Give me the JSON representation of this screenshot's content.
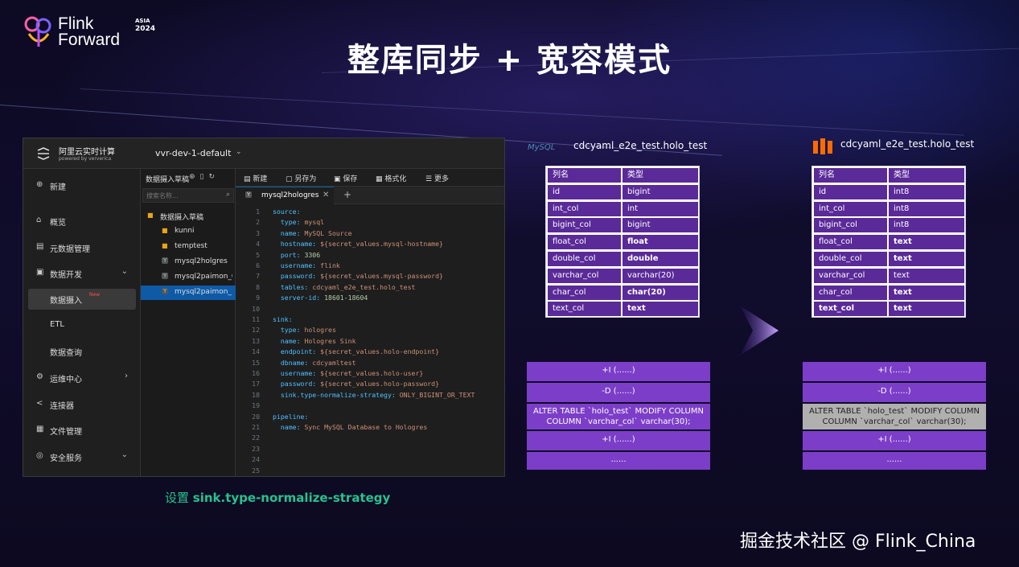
{
  "logo": {
    "line1": "Flink",
    "line2": "Forward",
    "event": "ASIA",
    "year": "2024"
  },
  "title": "整库同步 + 宽容模式",
  "app": {
    "brand": "阿里云实时计算",
    "brand_sub": "powered by ververica",
    "workspace": "vvr-dev-1-default",
    "sidebar": [
      {
        "label": "新建",
        "icon": "⊕"
      },
      {
        "label": "概览",
        "icon": "⌂"
      },
      {
        "label": "元数据管理",
        "icon": "▤"
      },
      {
        "label": "数据开发",
        "icon": "▣"
      },
      {
        "label": "数据摄入",
        "badge": "New"
      },
      {
        "label": "ETL"
      },
      {
        "label": "数据查询"
      },
      {
        "label": "运维中心",
        "icon": "⚙"
      },
      {
        "label": "连接器",
        "icon": "<"
      },
      {
        "label": "文件管理",
        "icon": "▦"
      },
      {
        "label": "安全服务",
        "icon": "◎"
      }
    ],
    "tree": {
      "header": "数据摄入草稿",
      "search_placeholder": "搜索名称...",
      "items": [
        "数据摄入草稿",
        "kunni",
        "temptest",
        "mysql2holgres",
        "mysql2paimon_0",
        "mysql2paimon_1"
      ]
    },
    "toolbar": {
      "new": "新建",
      "save_as": "另存为",
      "save": "保存",
      "format": "格式化",
      "more": "更多"
    },
    "tab": "mysql2hologres",
    "code": [
      "source:",
      "  type: mysql",
      "  name: MySQL Source",
      "  hostname: ${secret_values.mysql-hostname}",
      "  port: 3306",
      "  username: flink",
      "  password: ${secret_values.mysql-password}",
      "  tables: cdcyaml_e2e_test.holo_test",
      "  server-id: 18601-18604",
      "",
      "sink:",
      "  type: hologres",
      "  name: Hologres Sink",
      "  endpoint: ${secret_values.holo-endpoint}",
      "  dbname: cdcyamltest",
      "  username: ${secret_values.holo-user}",
      "  password: ${secret_values.holo-password}",
      "  sink.type-normalize-strategy: ONLY_BIGINT_OR_TEXT",
      "",
      "pipeline:",
      "  name: Sync MySQL Database to Hologres",
      "",
      "",
      "",
      ""
    ]
  },
  "caption": {
    "prefix": "设置 ",
    "param": "sink.type-normalize-strategy"
  },
  "mysql_table": {
    "logo": "MySQL",
    "name": "cdcyaml_e2e_test.holo_test",
    "headers": [
      "列名",
      "类型"
    ],
    "rows": [
      [
        "id",
        "bigint"
      ],
      [
        "int_col",
        "int"
      ],
      [
        "bigint_col",
        "bigint"
      ],
      [
        "float_col",
        "float"
      ],
      [
        "double_col",
        "double"
      ],
      [
        "varchar_col",
        "varchar(20)"
      ],
      [
        "char_col",
        "char(20)"
      ],
      [
        "text_col",
        "text"
      ]
    ]
  },
  "holo_table": {
    "name": "cdcyaml_e2e_test.holo_test",
    "headers": [
      "列名",
      "类型"
    ],
    "rows": [
      [
        "id",
        "int8"
      ],
      [
        "int_col",
        "int8"
      ],
      [
        "bigint_col",
        "int8"
      ],
      [
        "float_col",
        "text"
      ],
      [
        "double_col",
        "text"
      ],
      [
        "varchar_col",
        "text"
      ],
      [
        "char_col",
        "text"
      ],
      [
        "text_col",
        "text"
      ]
    ]
  },
  "ops": [
    "+I (......)",
    "-D (......)",
    "ALTER TABLE `holo_test` MODIFY COLUMN",
    "COLUMN `varchar_col` varchar(30);",
    "+I (......)",
    "......"
  ],
  "watermark": "掘金技术社区 @ Flink_China"
}
